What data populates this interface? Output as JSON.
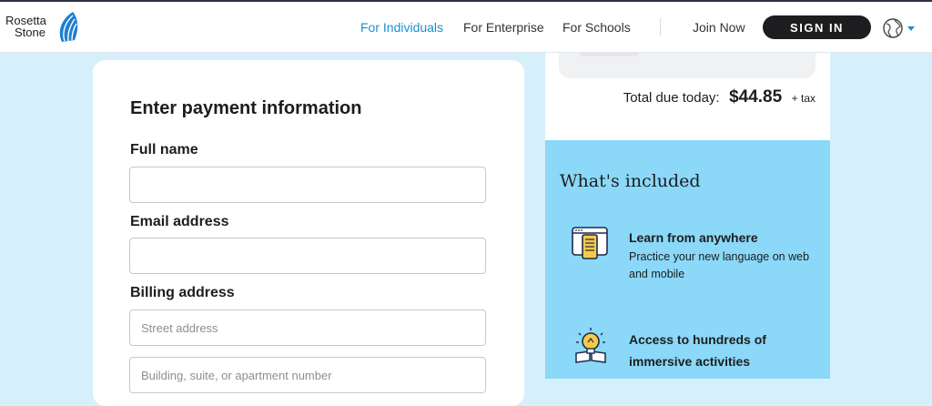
{
  "header": {
    "logo_line1": "Rosetta",
    "logo_line2": "Stone",
    "nav": [
      "For Individuals",
      "For Enterprise",
      "For Schools"
    ],
    "join_label": "Join Now",
    "signin_label": "SIGN IN",
    "accent_color": "#1a8fd0"
  },
  "payment": {
    "title": "Enter payment information",
    "full_name_label": "Full name",
    "full_name_value": "",
    "email_label": "Email address",
    "email_value": "",
    "billing_label": "Billing address",
    "street_placeholder": "Street address",
    "building_placeholder": "Building, suite, or apartment number"
  },
  "summary": {
    "total_label": "Total due today:",
    "total_amount": "$44.85",
    "tax_label": "+ tax"
  },
  "included": {
    "title": "What's included",
    "features": [
      {
        "icon": "device-icon",
        "title": "Learn from anywhere",
        "description": "Practice your new language on web and mobile"
      },
      {
        "icon": "lightbulb-book-icon",
        "title": "Access to hundreds of immersive activities",
        "description": ""
      }
    ],
    "panel_color": "#8bd8f8"
  }
}
